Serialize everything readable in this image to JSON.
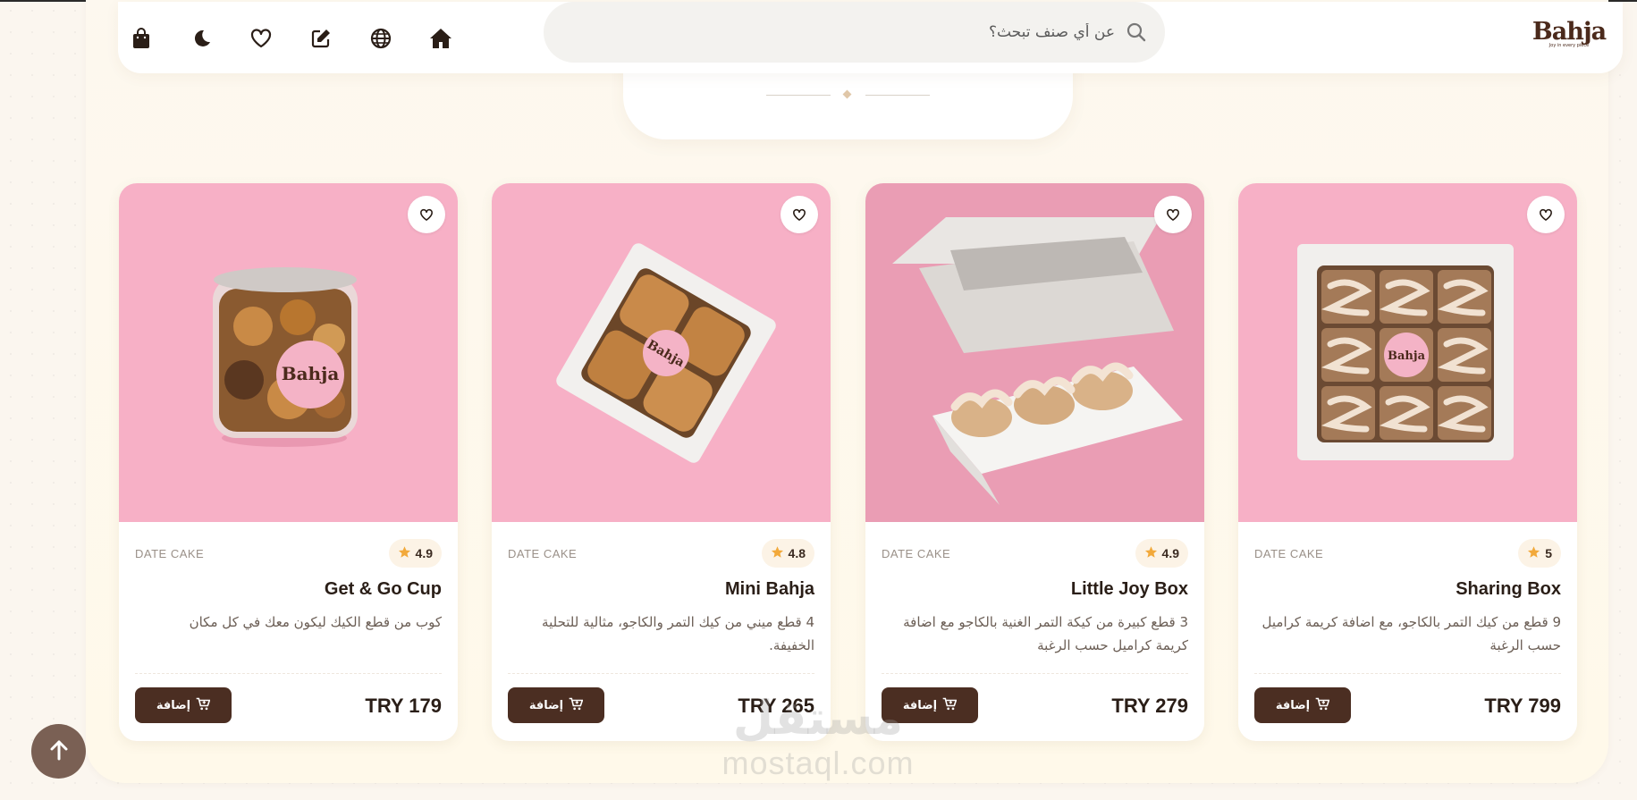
{
  "header": {
    "logo": {
      "text": "Bahja",
      "tagline": "Joy in every piece"
    },
    "search": {
      "placeholder": "عن أي صنف تبحث؟",
      "value": ""
    },
    "icons": [
      "bag-icon",
      "moon-icon",
      "heart-icon",
      "edit-icon",
      "globe-icon",
      "home-icon"
    ]
  },
  "products": [
    {
      "category": "DATE CAKE",
      "rating": "4.9",
      "title": "Get & Go Cup",
      "description": "كوب من قطع الكيك ليكون معك في كل مكان",
      "price": "TRY 179",
      "add_label": "إضافة"
    },
    {
      "category": "DATE CAKE",
      "rating": "4.8",
      "title": "Mini Bahja",
      "description": "4 قطع ميني من كيك التمر والكاجو، مثالية للتحلية الخفيفة.",
      "price": "TRY 265",
      "add_label": "إضافة"
    },
    {
      "category": "DATE CAKE",
      "rating": "4.9",
      "title": "Little Joy Box",
      "description": "3 قطع كبيرة من كيكة التمر الغنية بالكاجو مع اضافة كريمة كراميل حسب الرغبة",
      "price": "TRY 279",
      "add_label": "إضافة"
    },
    {
      "category": "DATE CAKE",
      "rating": "5",
      "title": "Sharing Box",
      "description": "9 قطع من كيك التمر بالكاجو، مع اضافة كريمة كراميل حسب الرغبة",
      "price": "TRY 799",
      "add_label": "إضافة"
    }
  ],
  "watermark": {
    "arabic": "مستقل",
    "latin": "mostaql.com"
  },
  "colors": {
    "brand": "#4b2e22",
    "card_image_bg": "#f7b0c6",
    "star": "#f2a93b",
    "page_bg": "#fbf6ef"
  }
}
